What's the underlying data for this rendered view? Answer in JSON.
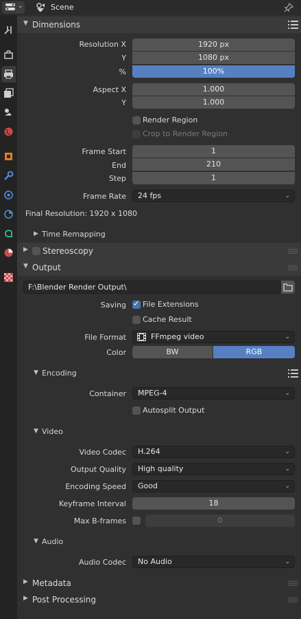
{
  "header": {
    "title": "Scene"
  },
  "dimensions": {
    "title": "Dimensions",
    "resolution_x_label": "Resolution X",
    "resolution_x": "1920 px",
    "y_label": "Y",
    "resolution_y": "1080 px",
    "percent_label": "%",
    "percent": "100%",
    "aspect_x_label": "Aspect X",
    "aspect_x": "1.000",
    "aspect_y_label": "Y",
    "aspect_y": "1.000",
    "render_region": "Render Region",
    "crop_region": "Crop to Render Region",
    "frame_start_label": "Frame Start",
    "frame_start": "1",
    "end_label": "End",
    "frame_end": "210",
    "step_label": "Step",
    "frame_step": "1",
    "frame_rate_label": "Frame Rate",
    "frame_rate": "24 fps",
    "final_resolution": "Final Resolution: 1920 x 1080",
    "time_remapping": "Time Remapping"
  },
  "stereoscopy": {
    "title": "Stereoscopy"
  },
  "output": {
    "title": "Output",
    "path": "F:\\Blender Render Output\\",
    "saving_label": "Saving",
    "file_extensions": "File Extensions",
    "cache_result": "Cache Result",
    "file_format_label": "File Format",
    "file_format": "FFmpeg video",
    "color_label": "Color",
    "color_bw": "BW",
    "color_rgb": "RGB"
  },
  "encoding": {
    "title": "Encoding",
    "container_label": "Container",
    "container": "MPEG-4",
    "autosplit": "Autosplit Output"
  },
  "video": {
    "title": "Video",
    "codec_label": "Video Codec",
    "codec": "H.264",
    "quality_label": "Output Quality",
    "quality": "High quality",
    "speed_label": "Encoding Speed",
    "speed": "Good",
    "keyframe_label": "Keyframe Interval",
    "keyframe": "18",
    "bframes_label": "Max B-frames",
    "bframes": "0"
  },
  "audio": {
    "title": "Audio",
    "codec_label": "Audio Codec",
    "codec": "No Audio"
  },
  "metadata": {
    "title": "Metadata"
  },
  "post_processing": {
    "title": "Post Processing"
  },
  "colors": {
    "accent": "#5680c2",
    "checkbox_on": "#4772b3",
    "panel_bg": "#303030",
    "header_bg": "#3a3a3a"
  }
}
